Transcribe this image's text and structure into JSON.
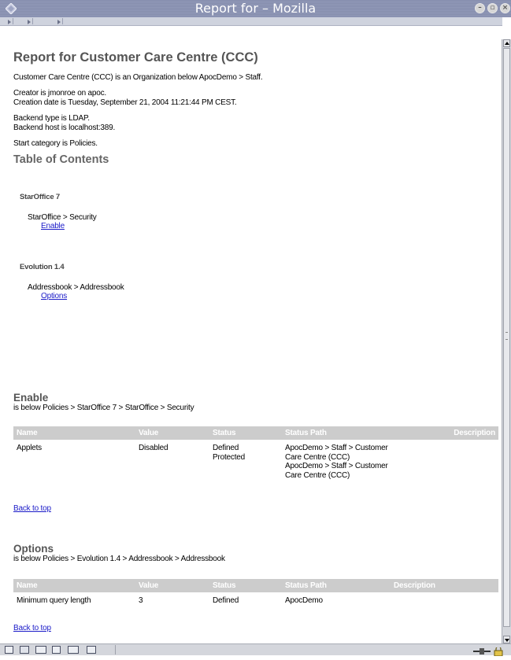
{
  "window": {
    "title": "Report for – Mozilla",
    "icon": "mozilla-diamond-icon",
    "buttons": [
      "minimize-icon",
      "maximize-icon",
      "close-icon"
    ]
  },
  "report": {
    "heading": "Report for Customer Care Centre (CCC)",
    "org_line": "Customer Care Centre (CCC) is an Organization below ApocDemo > Staff.",
    "creator": "Creator is jmonroe on apoc.",
    "creation_date": "Creation date is Tuesday, September 21, 2004 11:21:44 PM CEST.",
    "backend_type": "Backend type is LDAP.",
    "backend_host": "Backend host is localhost:389.",
    "start_category": "Start category is Policies.",
    "toc_title": "Table of Contents",
    "toc": [
      {
        "product": "StarOffice 7",
        "path": "StarOffice > Security",
        "link": "Enable"
      },
      {
        "product": "Evolution 1.4",
        "path": "Addressbook > Addressbook",
        "link": "Options"
      }
    ],
    "sections": [
      {
        "title": "Enable",
        "below": "is below Policies > StarOffice 7 > StarOffice > Security",
        "columns": [
          "Name",
          "Value",
          "Status",
          "Status Path",
          "Description"
        ],
        "rows": [
          {
            "name": "Applets",
            "value": "Disabled",
            "status_1": "Defined",
            "status_2": "Protected",
            "path_1": "ApocDemo > Staff > Customer",
            "path_2": "Care Centre (CCC)",
            "path_3": "ApocDemo > Staff > Customer",
            "path_4": "Care Centre (CCC)",
            "description": ""
          }
        ],
        "back_to_top": "Back to top"
      },
      {
        "title": "Options",
        "below": "is below Policies > Evolution 1.4 > Addressbook > Addressbook",
        "columns": [
          "Name",
          "Value",
          "Status",
          "Status Path",
          "Description"
        ],
        "rows": [
          {
            "name": "Minimum query length",
            "value": "3",
            "status": "Defined",
            "path": "ApocDemo",
            "description": ""
          }
        ],
        "back_to_top": "Back to top"
      }
    ]
  },
  "statusbar": {
    "icons": [
      "navigator-icon",
      "mail-icon",
      "composer-icon",
      "addressbook-icon",
      "chatzilla-icon",
      "offline-icon"
    ],
    "right_icons": [
      "connection-icon",
      "security-lock-icon"
    ]
  },
  "colors": {
    "titlebar": "#8a93b4",
    "header_row": "#cccccc",
    "link": "#1a1ac8"
  }
}
